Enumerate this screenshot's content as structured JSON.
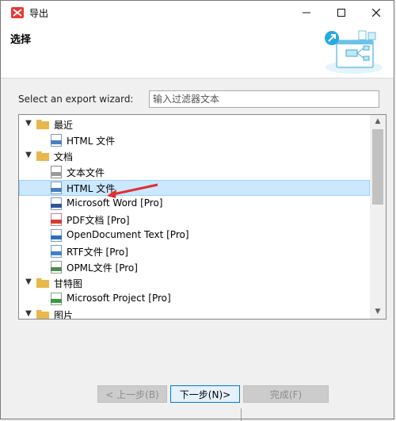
{
  "window": {
    "title": "导出"
  },
  "header": {
    "title": "选择"
  },
  "wizard": {
    "label": "Select an export wizard:",
    "filter_placeholder": "输入过滤器文本"
  },
  "tree": {
    "rows": [
      {
        "label": "最近",
        "type": "folder",
        "level": 0,
        "expanded": true
      },
      {
        "label": "HTML 文件",
        "type": "file",
        "icon": "html-file-icon",
        "level": 1
      },
      {
        "label": "文档",
        "type": "folder",
        "level": 0,
        "expanded": true
      },
      {
        "label": "文本文件",
        "type": "file",
        "icon": "txt-file-icon",
        "level": 1
      },
      {
        "label": "HTML 文件",
        "type": "file",
        "icon": "html-file-icon",
        "level": 1,
        "selected": true
      },
      {
        "label": "Microsoft Word [Pro]",
        "type": "file",
        "icon": "doc-file-icon",
        "level": 1
      },
      {
        "label": "PDF文档 [Pro]",
        "type": "file",
        "icon": "pdf-file-icon",
        "level": 1
      },
      {
        "label": "OpenDocument Text [Pro]",
        "type": "file",
        "icon": "odt-file-icon",
        "level": 1
      },
      {
        "label": "RTF文件 [Pro]",
        "type": "file",
        "icon": "rtf-file-icon",
        "level": 1
      },
      {
        "label": "OPML文件 [Pro]",
        "type": "file",
        "icon": "opml-file-icon",
        "level": 1
      },
      {
        "label": "甘特图",
        "type": "folder",
        "level": 0,
        "expanded": true
      },
      {
        "label": "Microsoft Project [Pro]",
        "type": "file",
        "icon": "mpp-file-icon",
        "level": 1
      },
      {
        "label": "图片",
        "type": "folder",
        "level": 0,
        "expanded": true
      }
    ]
  },
  "buttons": {
    "back": "< 上一步(B)",
    "next": "下一步(N)>",
    "finish": "完成(F)"
  },
  "colors": {
    "selection": "#cce8ff",
    "folder": "#e8b84a",
    "accent": "#0078d7",
    "arrow": "#e03030"
  }
}
